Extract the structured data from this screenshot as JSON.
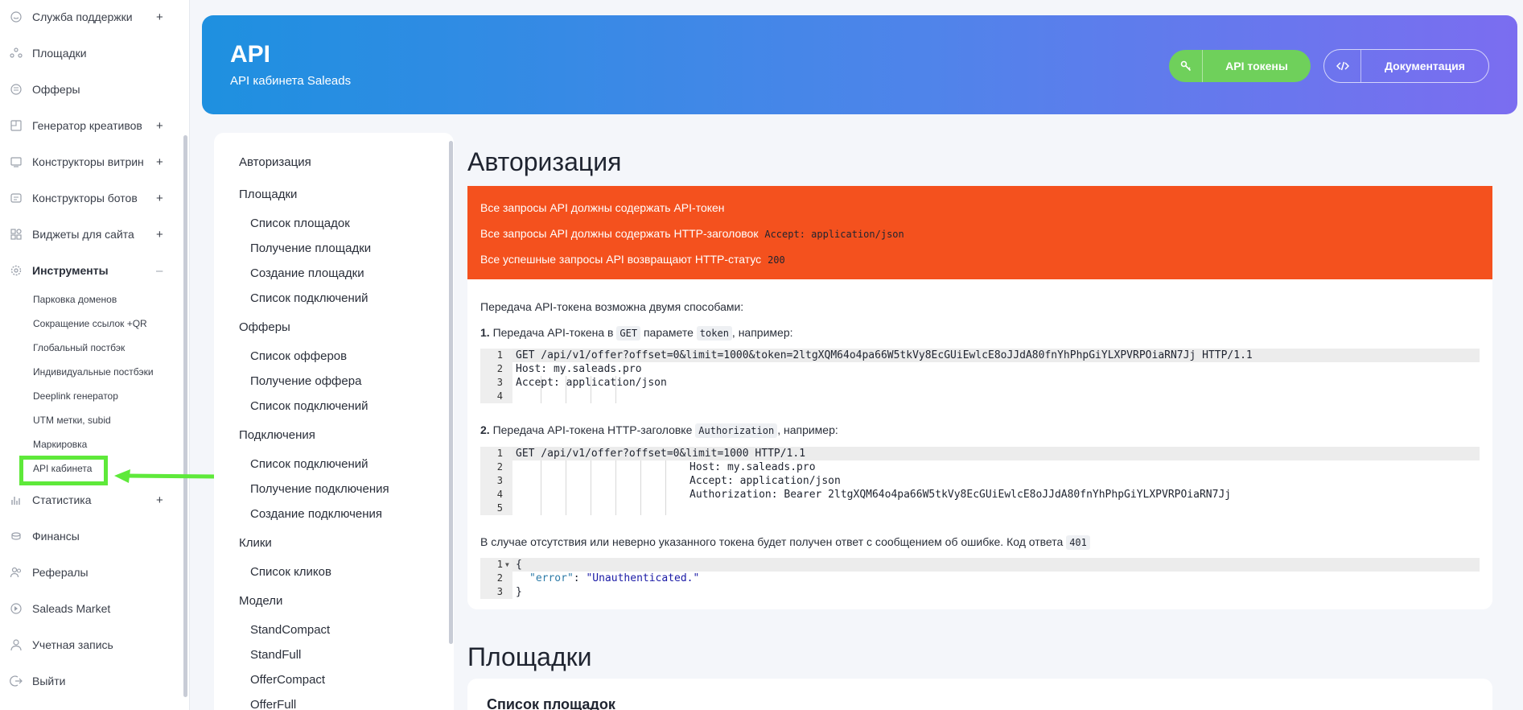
{
  "sidebar": {
    "items": [
      {
        "label": "Служба поддержки",
        "icon": "chat-icon",
        "expand": "+"
      },
      {
        "label": "Площадки",
        "icon": "sites-icon"
      },
      {
        "label": "Офферы",
        "icon": "offers-icon"
      },
      {
        "label": "Генератор креативов",
        "icon": "creative-icon",
        "expand": "+"
      },
      {
        "label": "Конструкторы витрин",
        "icon": "showcase-icon",
        "expand": "+"
      },
      {
        "label": "Конструкторы ботов",
        "icon": "bot-icon",
        "expand": "+"
      },
      {
        "label": "Виджеты для сайта",
        "icon": "widget-icon",
        "expand": "+"
      },
      {
        "label": "Инструменты",
        "icon": "tools-icon",
        "expand": "–"
      }
    ],
    "tools_submenu": [
      "Парковка доменов",
      "Сокращение ссылок +QR",
      "Глобальный постбэк",
      "Индивидуальные постбэки",
      "Deeplink генератор",
      "UTM метки, subid",
      "Маркировка",
      "API кабинета"
    ],
    "items_after": [
      {
        "label": "Статистика",
        "icon": "stats-icon",
        "expand": "+"
      },
      {
        "label": "Финансы",
        "icon": "finance-icon"
      },
      {
        "label": "Рефералы",
        "icon": "referrals-icon"
      },
      {
        "label": "Saleads Market",
        "icon": "market-icon"
      },
      {
        "label": "Учетная запись",
        "icon": "user-icon"
      },
      {
        "label": "Выйти",
        "icon": "logout-icon"
      }
    ],
    "highlight_color": "#5ee93a"
  },
  "header": {
    "title": "API",
    "subtitle": "API кабинета Saleads",
    "tokens_button": "API токены",
    "docs_button": "Документация",
    "tokens_color": "#6fd05b"
  },
  "toc": {
    "sections": [
      {
        "label": "Авторизация",
        "items": []
      },
      {
        "label": "Площадки",
        "items": [
          "Список площадок",
          "Получение площадки",
          "Создание площадки",
          "Список подключений"
        ]
      },
      {
        "label": "Офферы",
        "items": [
          "Список офферов",
          "Получение оффера",
          "Список подключений"
        ]
      },
      {
        "label": "Подключения",
        "items": [
          "Список подключений",
          "Получение подключения",
          "Создание подключения"
        ]
      },
      {
        "label": "Клики",
        "items": [
          "Список кликов"
        ]
      },
      {
        "label": "Модели",
        "items": [
          "StandCompact",
          "StandFull",
          "OfferCompact",
          "OfferFull"
        ]
      }
    ]
  },
  "content": {
    "auth_heading": "Авторизация",
    "alert_color": "#f4511e",
    "alert": {
      "line1": "Все запросы API должны содержать API-токен",
      "line2_text": "Все запросы API должны содержать HTTP-заголовок",
      "line2_code": "Accept: application/json",
      "line3_text": "Все успешные запросы API возвращают HTTP-статус",
      "line3_code": "200"
    },
    "intro": "Передача API-токена возможна двумя способами:",
    "method1": {
      "prefix": "1.",
      "text_a": " Передача API-токена в ",
      "code_a": "GET",
      "text_b": " парамете ",
      "code_b": "token",
      "text_c": ", например:"
    },
    "code1": {
      "line_numbers": [
        "1",
        "2",
        "3",
        "4"
      ],
      "lines": [
        "GET /api/v1/offer?offset=0&limit=1000&token=2ltgXQM64o4pa66W5tkVy8EcGUiEwlcE8oJJdA80fnYhPhpGiYLXPVRPOiaRN7Jj HTTP/1.1",
        "Host: my.saleads.pro",
        "Accept: application/json",
        ""
      ]
    },
    "method2": {
      "prefix": "2.",
      "text_a": " Передача API-токена HTTP-заголовке ",
      "code_a": "Authorization",
      "text_b": ", например:"
    },
    "code2": {
      "line_numbers": [
        "1",
        "2",
        "3",
        "4",
        "5"
      ],
      "lines": [
        "GET /api/v1/offer?offset=0&limit=1000 HTTP/1.1",
        "Host: my.saleads.pro",
        "Accept: application/json",
        "Authorization: Bearer 2ltgXQM64o4pa66W5tkVy8EcGUiEwlcE8oJJdA80fnYhPhpGiYLXPVRPOiaRN7Jj",
        ""
      ]
    },
    "error_text": "В случае отсутствия или неверно указанного токена будет получен ответ с сообщением об ошибке. Код ответа",
    "error_code": "401",
    "code3": {
      "line_numbers": [
        "1",
        "2",
        "3"
      ],
      "open": "{",
      "key": "\"error\"",
      "colon": ": ",
      "value": "\"Unauthenticated.\"",
      "close": "}"
    },
    "platforms_heading": "Площадки",
    "platforms_card_title": "Список площадок"
  }
}
